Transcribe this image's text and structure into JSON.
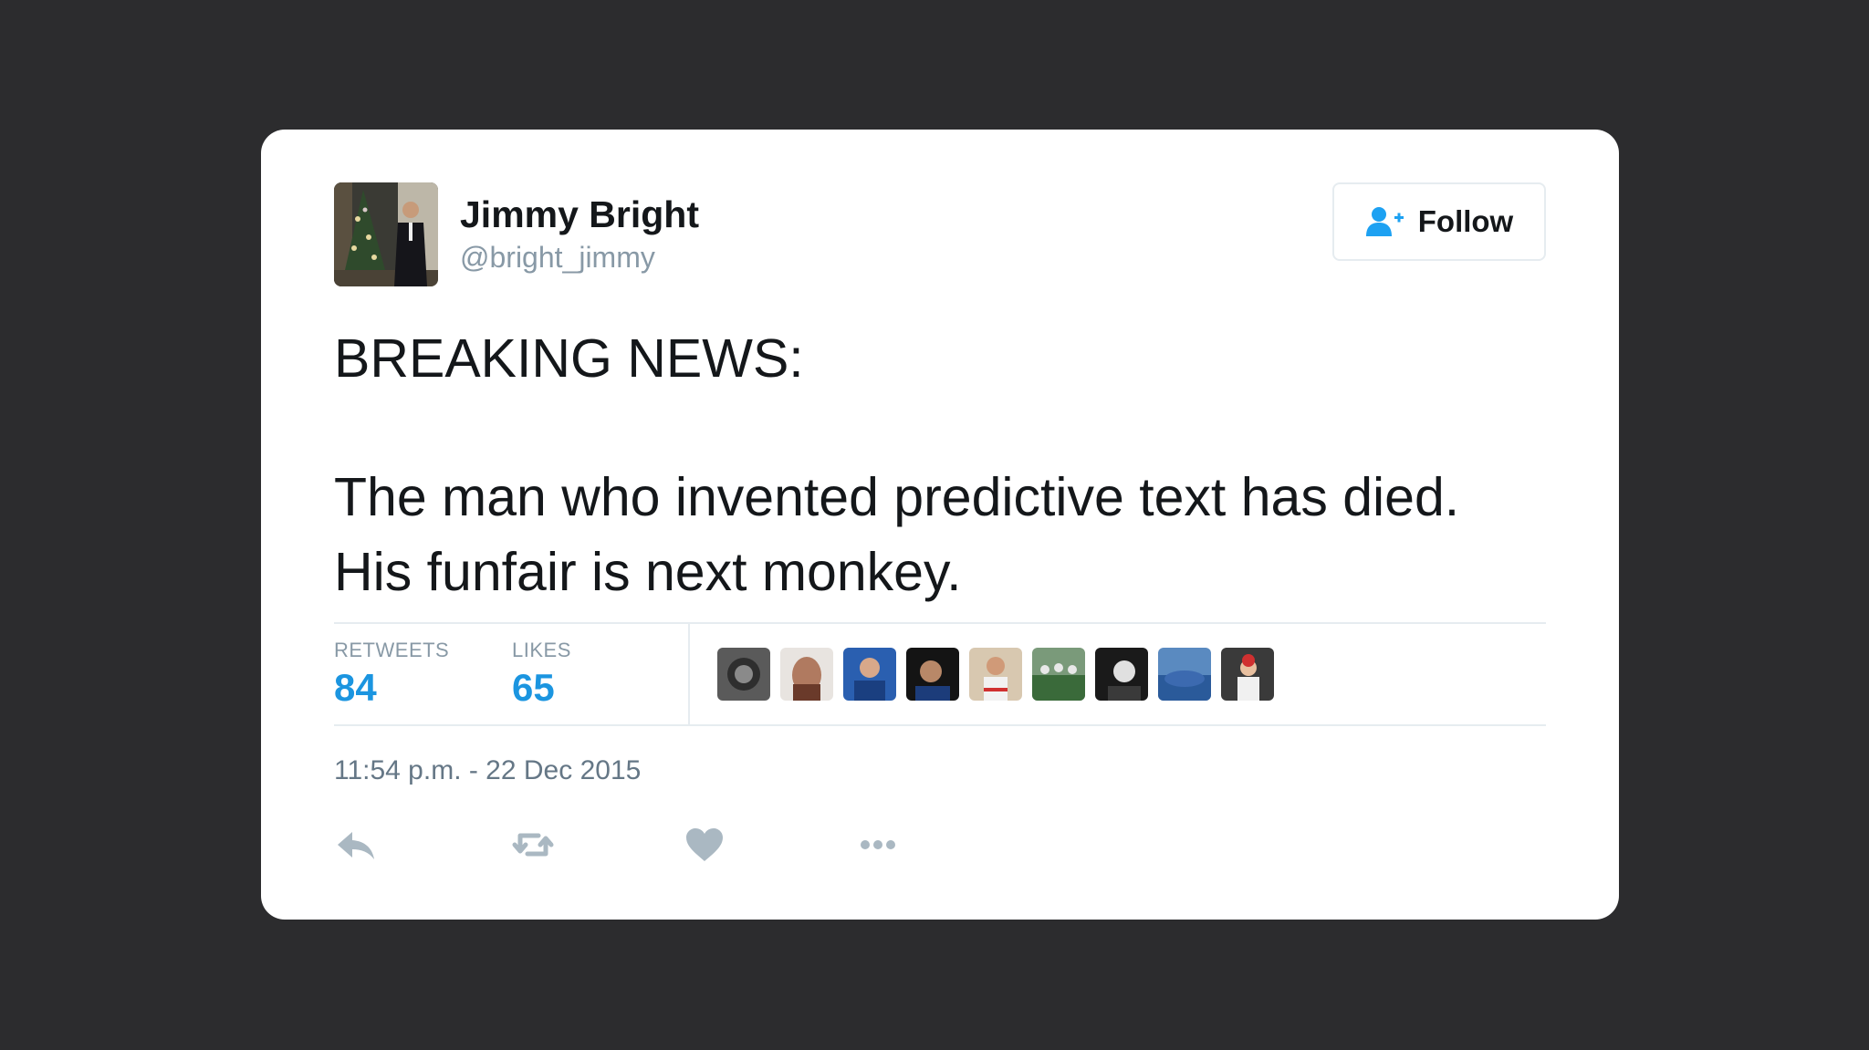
{
  "user": {
    "name": "Jimmy Bright",
    "handle": "@bright_jimmy"
  },
  "follow_button": {
    "label": "Follow",
    "icon": "add-user-icon"
  },
  "tweet": {
    "lines": [
      "BREAKING NEWS:",
      "The man who invented predictive text has died.",
      "His funfair is next monkey."
    ]
  },
  "stats": {
    "retweets_label": "RETWEETS",
    "retweets_count": "84",
    "likes_label": "LIKES",
    "likes_count": "65"
  },
  "likers_count_shown": 9,
  "timestamp": "11:54 p.m. - 22 Dec 2015",
  "actions": [
    "reply-icon",
    "retweet-icon",
    "like-icon",
    "more-icon"
  ],
  "colors": {
    "background": "#2c2c2e",
    "card": "#ffffff",
    "accent": "#1b95e0",
    "muted": "#8899a6",
    "text": "#14171a"
  }
}
